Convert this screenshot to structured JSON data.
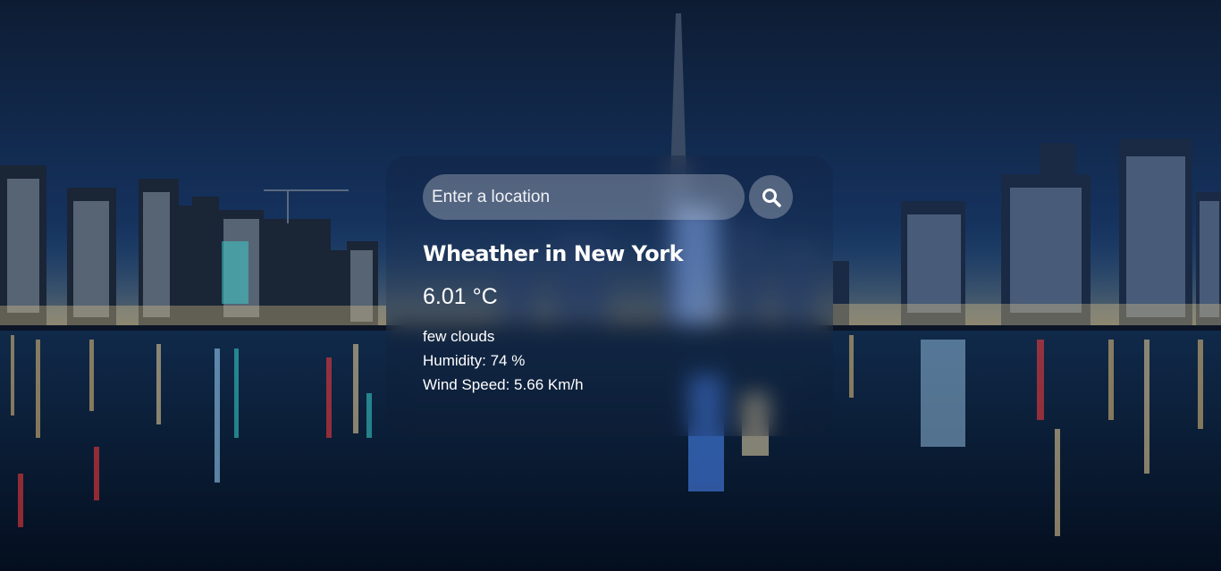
{
  "search": {
    "placeholder": "Enter a location",
    "value": ""
  },
  "weather": {
    "title": "Wheather in New York",
    "temperature": "6.01 °C",
    "description": "few clouds",
    "humidity": "Humidity: 74 %",
    "wind_speed": "Wind Speed: 5.66 Km/h"
  },
  "icons": {
    "search_button": "search-icon"
  },
  "colors": {
    "sky_top": "#0d1c33",
    "sky_horizon": "#1c3f6c",
    "water": "#06152b",
    "text": "#ffffff"
  }
}
